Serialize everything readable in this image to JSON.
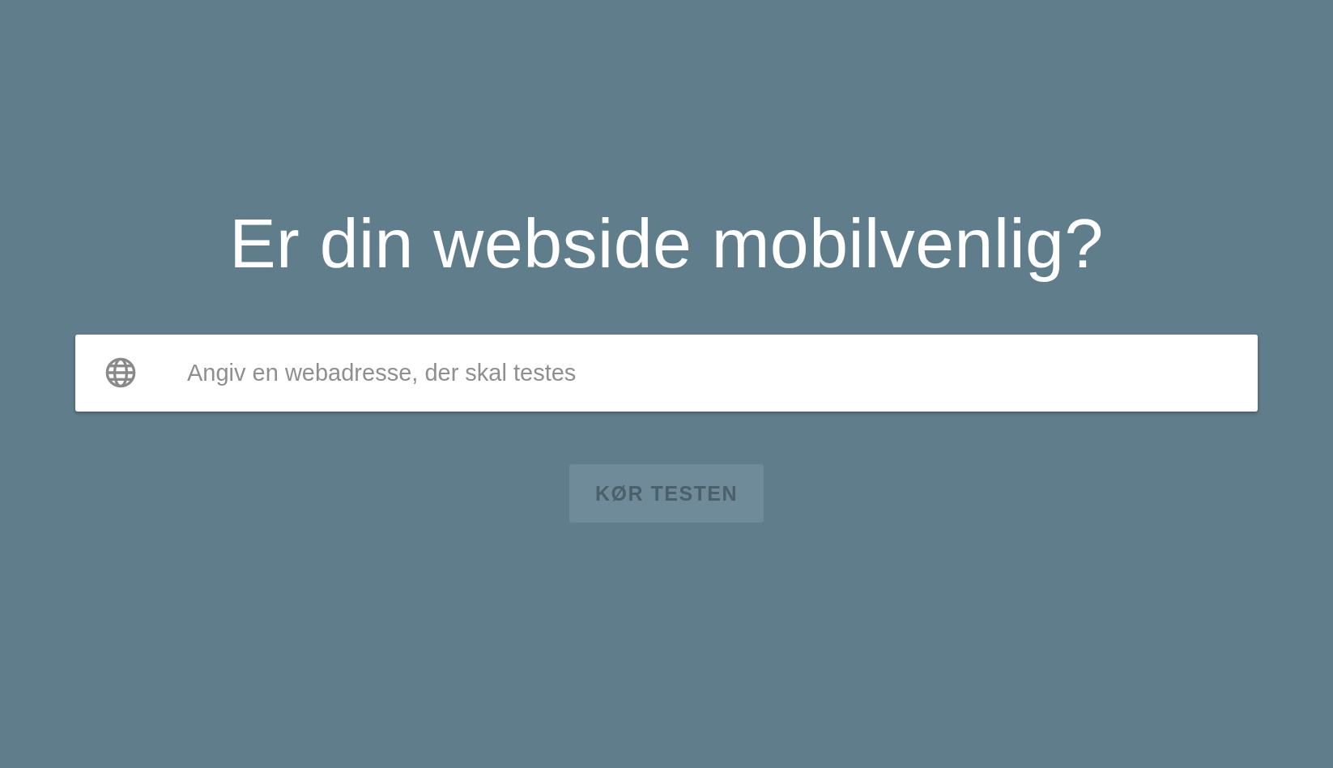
{
  "title": "Er din webside mobilvenlig?",
  "search": {
    "placeholder": "Angiv en webadresse, der skal testes"
  },
  "button": {
    "label": "KØR TESTEN",
    "disabled": true
  }
}
